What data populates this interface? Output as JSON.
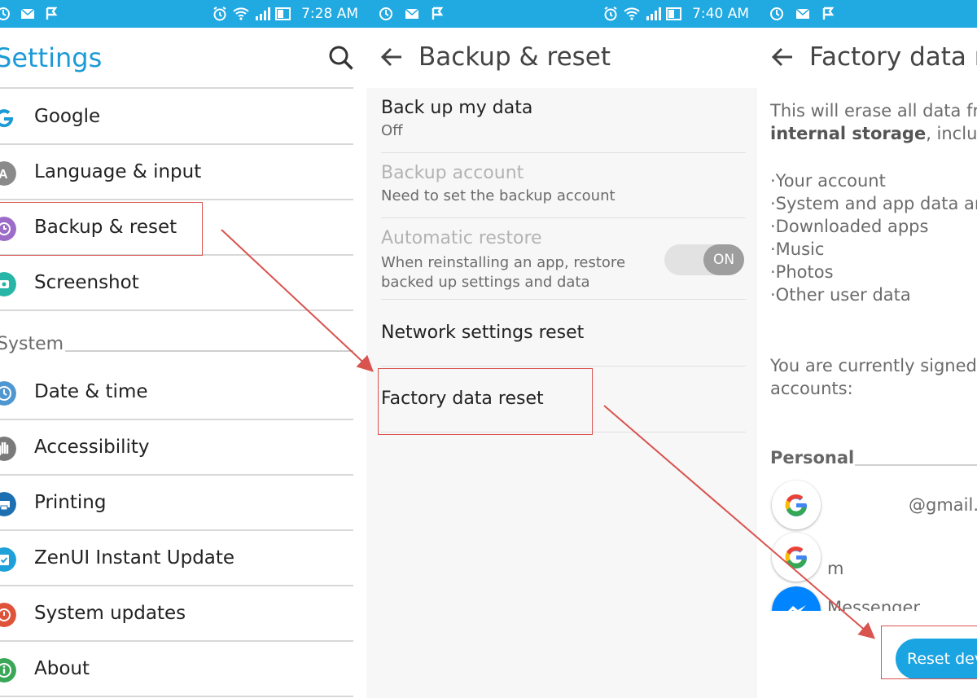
{
  "colors": {
    "status_bar": "#21a9e1",
    "accent": "#1c9ad6",
    "annotation_red": "#d9534f",
    "button_blue": "#1aa4e2"
  },
  "status_bar_1": {
    "time": "7:28 AM"
  },
  "status_bar_2": {
    "time": "7:40 AM"
  },
  "settings": {
    "title": "Settings",
    "items": [
      {
        "label": "Google",
        "icon": "google-icon"
      },
      {
        "label": "Language & input",
        "icon": "language-icon"
      },
      {
        "label": "Backup & reset",
        "icon": "backup-icon"
      },
      {
        "label": "Screenshot",
        "icon": "screenshot-icon"
      }
    ],
    "system_label": "System",
    "system_items": [
      {
        "label": "Date & time",
        "icon": "clock-icon"
      },
      {
        "label": "Accessibility",
        "icon": "hand-icon"
      },
      {
        "label": "Printing",
        "icon": "printer-icon"
      },
      {
        "label": "ZenUI Instant Update",
        "icon": "update-icon"
      },
      {
        "label": "System updates",
        "icon": "system-update-icon"
      },
      {
        "label": "About",
        "icon": "info-icon"
      }
    ]
  },
  "backup": {
    "title": "Backup & reset",
    "items": [
      {
        "title": "Back up my data",
        "subtitle": "Off"
      },
      {
        "title": "Backup account",
        "subtitle": "Need to set the backup account"
      },
      {
        "title": "Automatic restore",
        "subtitle_line1": "When reinstalling an app, restore",
        "subtitle_line2": "backed up settings and data",
        "toggle": "ON"
      },
      {
        "title": "Network settings reset"
      },
      {
        "title": "Factory data reset"
      }
    ]
  },
  "factory": {
    "title": "Factory data re",
    "intro_line1": "This will erase all data fr",
    "intro_strong": "internal storage",
    "intro_line2_rest": ", includin",
    "list": [
      "·Your account",
      "·System and app data an",
      "·Downloaded apps",
      "·Music",
      "·Photos",
      "·Other user data"
    ],
    "signed_line1": "You are currently signed",
    "signed_line2": "accounts:",
    "personal_label": "Personal",
    "account1": "@gmail.",
    "account2": "m",
    "account3": "Messenger",
    "reset_button": "Reset dev"
  }
}
